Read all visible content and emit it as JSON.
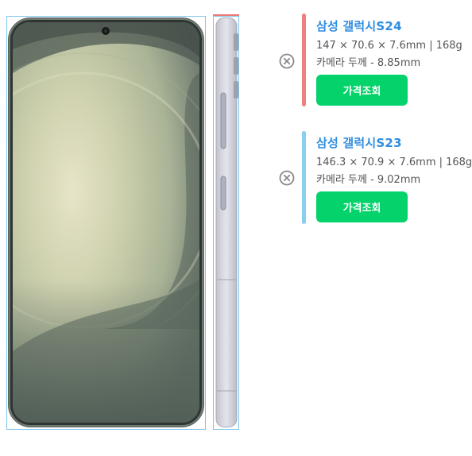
{
  "models": [
    {
      "name": "삼성 갤럭시S24",
      "dimensions": "147 × 70.6 × 7.6mm | 168g",
      "camera": "카메라 두께 - 8.85mm",
      "button_label": "가격조회",
      "bar_color": "#ef8080"
    },
    {
      "name": "삼성 갤럭시S23",
      "dimensions": "146.3 × 70.9 × 7.6mm | 168g",
      "camera": "카메라 두께 - 9.02mm",
      "button_label": "가격조회",
      "bar_color": "#86cff0"
    }
  ],
  "colors": {
    "accent_text": "#2f8ee0",
    "button_green": "#04d26b",
    "outline_blue": "#7fc6ec",
    "outline_red": "#ef7777"
  },
  "icons": {
    "remove": "close-circle-icon"
  }
}
